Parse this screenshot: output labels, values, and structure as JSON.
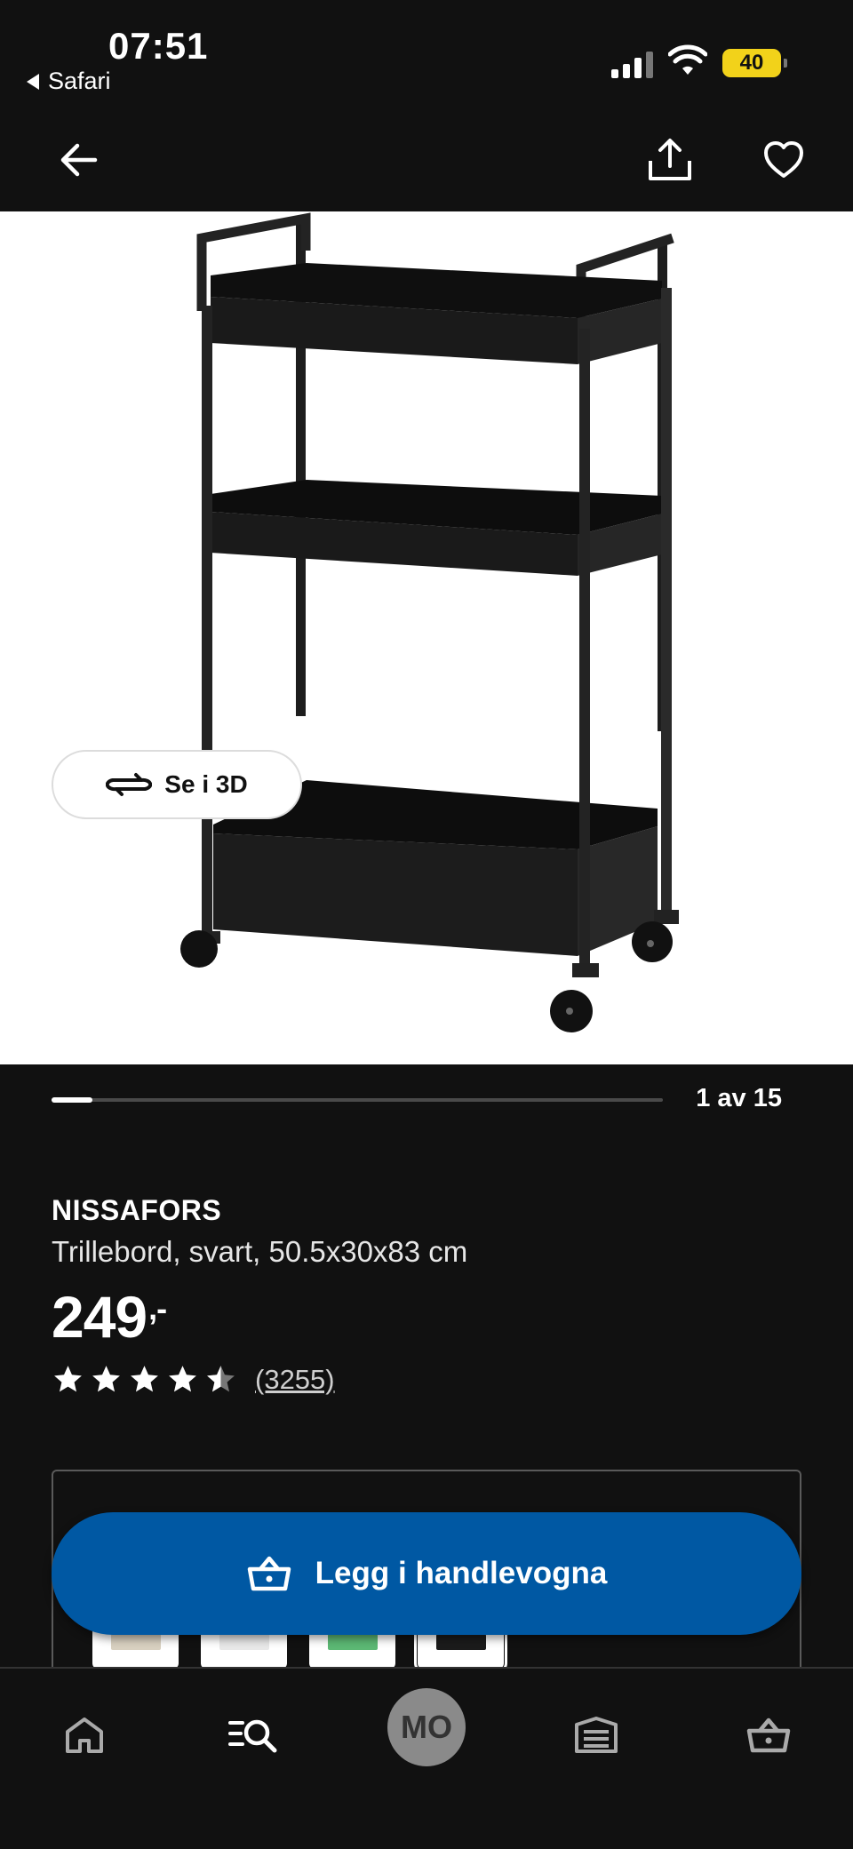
{
  "status_bar": {
    "time": "07:51",
    "back_app": "Safari",
    "battery": "40",
    "icons": [
      "cellular-signal-icon",
      "wifi-icon",
      "battery-icon"
    ]
  },
  "nav": {
    "icons": [
      "arrow-left-icon",
      "share-icon",
      "heart-icon"
    ]
  },
  "gallery": {
    "view_3d_label": "Se i 3D",
    "counter": "1 av 15",
    "current": 1,
    "total": 15
  },
  "product": {
    "name": "NISSAFORS",
    "description": "Trillebord, svart, 50.5x30x83 cm",
    "price": "249",
    "price_suffix": ",-",
    "rating_value": 4.5,
    "rating_max": 5,
    "review_count": "(3255)"
  },
  "variants": {
    "swatches": [
      {
        "name": "beige",
        "color": "#d8d0c0"
      },
      {
        "name": "white",
        "color": "#e8e8e8"
      },
      {
        "name": "green",
        "color": "#5cb874"
      },
      {
        "name": "black",
        "color": "#1b1b1b",
        "selected": true
      }
    ]
  },
  "cta": {
    "label": "Legg i handlevogna",
    "color": "#0058a3"
  },
  "tabbar": {
    "avatar_initials": "MO",
    "icons": [
      "home-icon",
      "search-list-icon",
      "avatar",
      "store-icon",
      "basket-icon"
    ]
  }
}
